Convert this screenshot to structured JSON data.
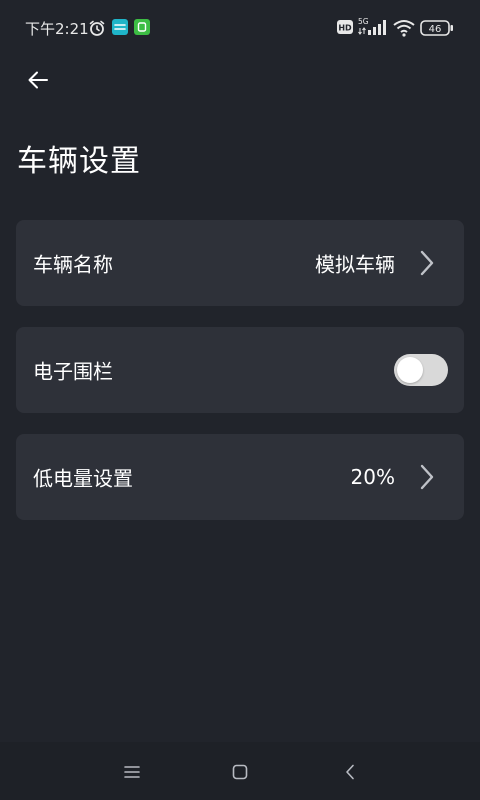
{
  "status_bar": {
    "time": "下午2:21",
    "network": "5G",
    "hd": "HD",
    "battery": "46"
  },
  "page": {
    "title": "车辆设置"
  },
  "settings": {
    "vehicle_name": {
      "label": "车辆名称",
      "value": "模拟车辆"
    },
    "geofence": {
      "label": "电子围栏",
      "enabled": false
    },
    "low_battery": {
      "label": "低电量设置",
      "value": "20%"
    }
  },
  "colors": {
    "background": "#21242b",
    "card": "#2e3139",
    "toggle_off": "#d9d9d9",
    "app_teal": "#1fb5c9",
    "app_green": "#3dbd44"
  },
  "icons": {
    "back": "arrow-left-icon",
    "chevron": "chevron-right-icon",
    "nav_menu": "menu-icon",
    "nav_home": "home-square-icon",
    "nav_back": "chevron-left-icon"
  }
}
